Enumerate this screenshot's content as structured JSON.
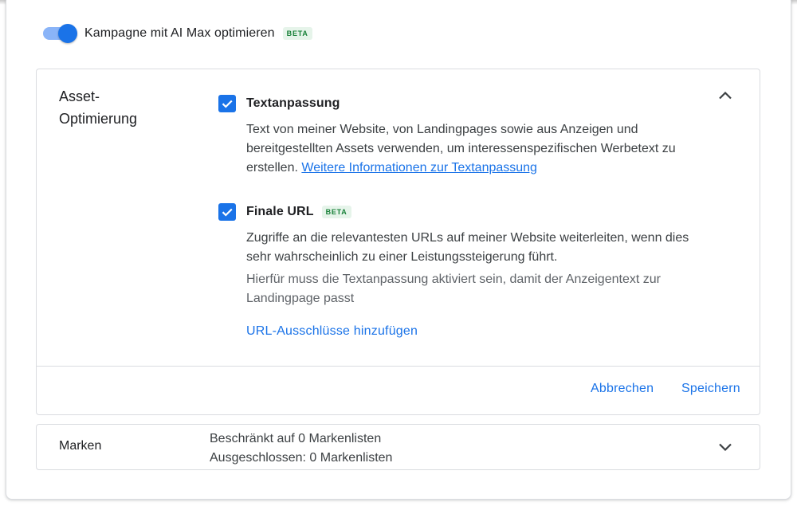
{
  "toggle": {
    "label": "Kampagne mit AI Max optimieren",
    "badge": "BETA",
    "checked": true,
    "color": "#1a73e8"
  },
  "asset_card": {
    "title_line1": "Asset-",
    "title_line2": "Optimierung",
    "collapse_icon": "chevron-up-icon",
    "options": [
      {
        "title": "Textanpassung",
        "checked": true,
        "description": "Text von meiner Website, von Landingpages sowie aus Anzeigen und bereitgestellten Assets verwenden, um interessenspezifischen Werbetext zu erstellen.",
        "link": "Weitere Informationen zur Textanpassung"
      },
      {
        "title": "Finale URL",
        "badge": "BETA",
        "checked": true,
        "description": "Zugriffe an die relevantesten URLs auf meiner Website weiterleiten, wenn dies sehr wahrscheinlich zu einer Leistungssteigerung führt.",
        "note": "Hierfür muss die Textanpassung aktiviert sein, damit der Anzeigentext zur Landingpage passt"
      }
    ],
    "add_exclusions": "URL-Ausschlüsse hinzufügen",
    "cancel": "Abbrechen",
    "save": "Speichern"
  },
  "brands_card": {
    "title": "Marken",
    "summary_line1": "Beschränkt auf 0 Markenlisten",
    "summary_line2": "Ausgeschlossen: 0 Markenlisten",
    "expand_icon": "chevron-down-icon"
  },
  "colors": {
    "accent": "#1a73e8",
    "badge_text": "#188038",
    "badge_bg": "#e6f4ea"
  }
}
